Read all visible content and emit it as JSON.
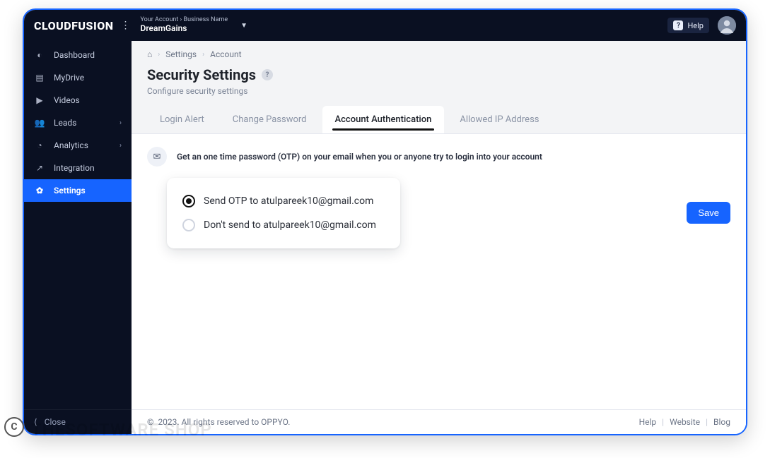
{
  "brand": "CLOUDFUSION",
  "account": {
    "top_line": "Your Account › Business Name",
    "name": "DreamGains"
  },
  "help_label": "Help",
  "sidebar": {
    "items": [
      {
        "label": "Dashboard",
        "icon": "gauge-icon"
      },
      {
        "label": "MyDrive",
        "icon": "drive-icon"
      },
      {
        "label": "Videos",
        "icon": "video-icon"
      },
      {
        "label": "Leads",
        "icon": "users-icon",
        "chevron": true
      },
      {
        "label": "Analytics",
        "icon": "analytics-icon",
        "chevron": true
      },
      {
        "label": "Integration",
        "icon": "rocket-icon"
      },
      {
        "label": "Settings",
        "icon": "gear-icon",
        "active": true
      }
    ],
    "close_label": "Close"
  },
  "breadcrumbs": [
    "Settings",
    "Account"
  ],
  "page": {
    "title": "Security Settings",
    "subtitle": "Configure security settings"
  },
  "tabs": [
    {
      "label": "Login Alert"
    },
    {
      "label": "Change Password"
    },
    {
      "label": "Account Authentication",
      "active": true
    },
    {
      "label": "Allowed IP Address"
    }
  ],
  "auth_panel": {
    "description": "Get an one time password (OTP) on your email when you or anyone try to login into your account",
    "option_send": "Send OTP to atulpareek10@gmail.com",
    "option_dont": "Don't send to atulpareek10@gmail.com",
    "selected": "send"
  },
  "save_label": "Save",
  "footer": {
    "copyright": "2023. All rights reserved to OPPYO.",
    "links": [
      "Help",
      "Website",
      "Blog"
    ]
  },
  "watermark": "THESOFTWARE SHOP"
}
